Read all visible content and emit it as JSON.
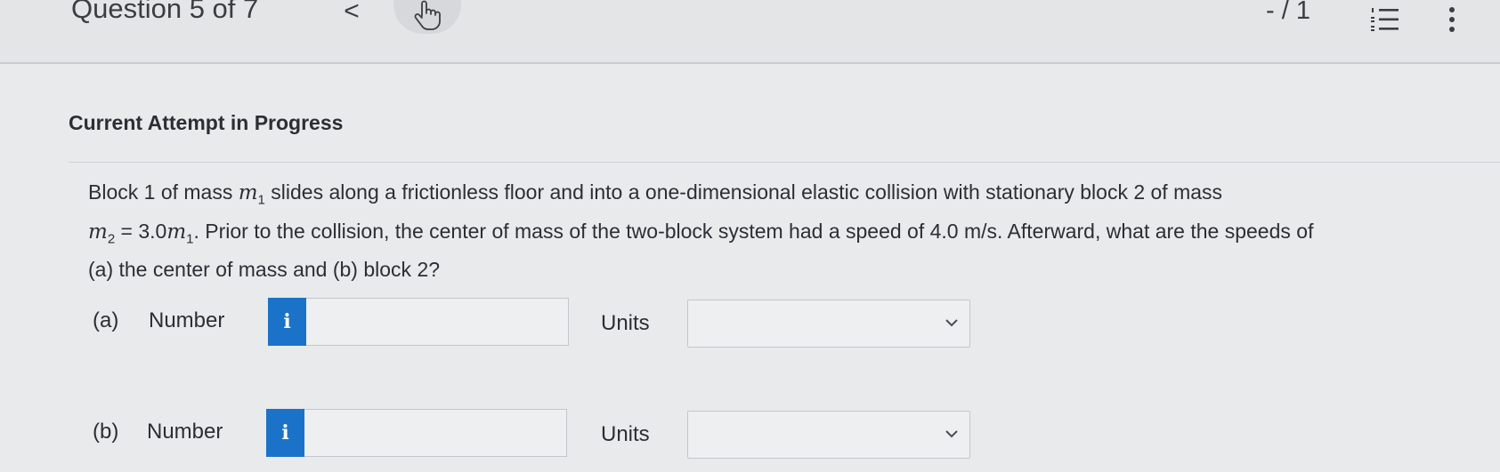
{
  "header": {
    "question_counter": "Question 5 of 7",
    "prev_label": "<",
    "score": "- / 1",
    "icons": [
      "chevron-left-icon",
      "hand-pointer-icon",
      "numbered-list-icon",
      "kebab-menu-icon"
    ]
  },
  "attempt_title": "Current Attempt in Progress",
  "question": {
    "line1_a": "Block 1 of mass ",
    "m": "m",
    "sub1": "1",
    "line1_b": " slides along a frictionless floor and into a one-dimensional elastic collision with stationary block 2 of mass",
    "sub2": "2",
    "eq": " = 3.0",
    "line2_b": ". Prior to the collision, the center of mass of the two-block system had a speed of 4.0 m/s. Afterward, what are the speeds of",
    "line3": "(a) the center of mass and (b) block 2?"
  },
  "parts": [
    {
      "label": "(a)",
      "number_label": "Number",
      "info": "i",
      "value": "",
      "units_label": "Units",
      "units_value": ""
    },
    {
      "label": "(b)",
      "number_label": "Number",
      "info": "i",
      "value": "",
      "units_label": "Units",
      "units_value": ""
    }
  ],
  "colors": {
    "accent": "#1a73c8",
    "background": "#e9eaec",
    "text": "#2b2f33"
  }
}
